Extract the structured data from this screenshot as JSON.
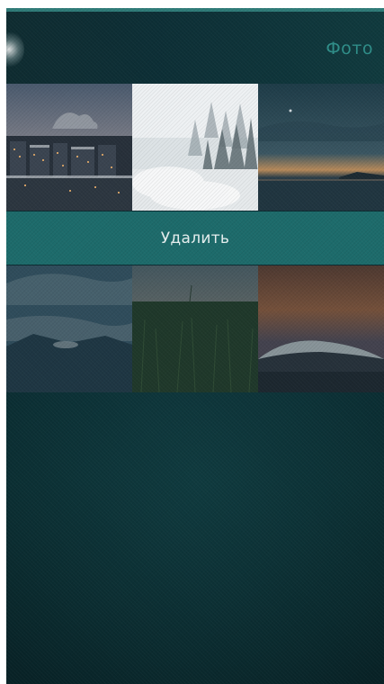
{
  "header": {
    "title": "Фото"
  },
  "actions": {
    "delete_label": "Удалить"
  },
  "photos": [
    {
      "icon": "city-night-photo"
    },
    {
      "icon": "snowy-forest-photo"
    },
    {
      "icon": "lake-sunset-photo"
    },
    {
      "icon": "cloudy-sky-photo"
    },
    {
      "icon": "grass-field-photo"
    },
    {
      "icon": "snowy-hill-sunset-photo"
    }
  ],
  "colors": {
    "accent": "#1d6b6b",
    "title": "#2f8f8a",
    "background": "#0a2b31"
  }
}
